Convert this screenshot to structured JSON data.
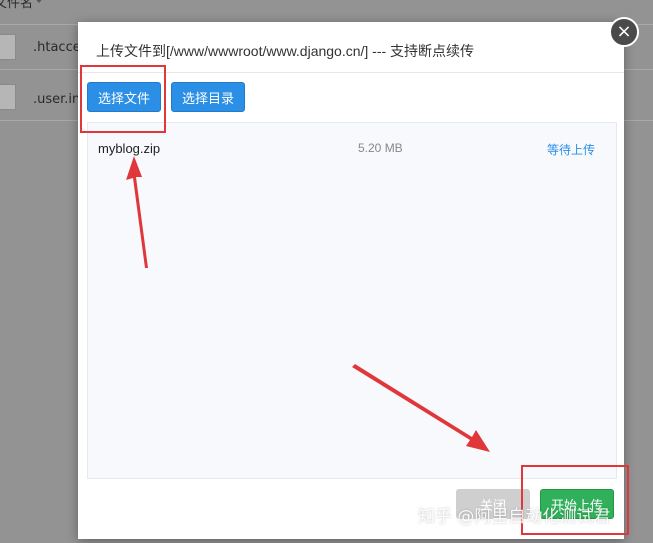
{
  "background": {
    "header": "文件名",
    "files": [
      ".htacces",
      ".user.in"
    ]
  },
  "dialog": {
    "title": "上传文件到[/www/wwwroot/www.django.cn/] --- 支持断点续传",
    "close_glyph": "×",
    "buttons": {
      "select_file": "选择文件",
      "select_dir": "选择目录",
      "close": "关闭",
      "start": "开始上传"
    },
    "files": [
      {
        "name": "myblog.zip",
        "size": "5.20 MB",
        "status": "等待上传"
      }
    ]
  },
  "watermark": "知乎 @阿里自动化测试君",
  "colors": {
    "accent_blue": "#2b8fe6",
    "start_green": "#30b05a",
    "annotation_red": "#e0383a"
  },
  "icons": [
    "close-icon",
    "file-icon",
    "sort-caret-icon"
  ]
}
